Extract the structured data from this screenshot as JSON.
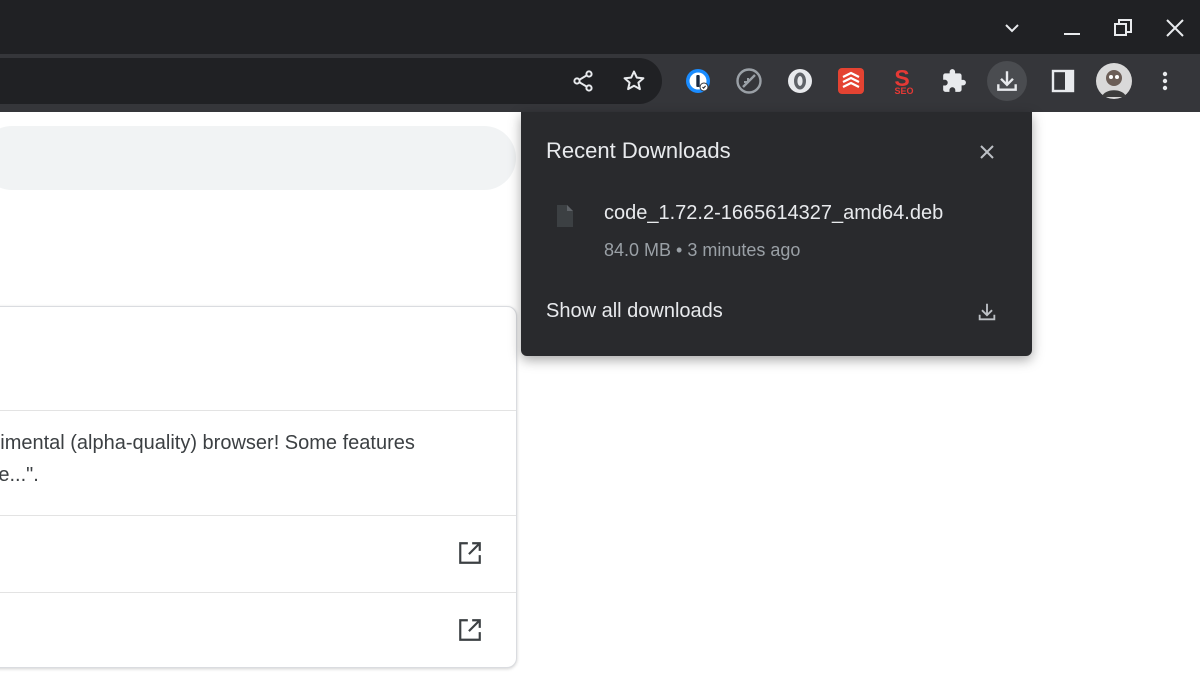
{
  "window_controls": {
    "icons": [
      "chevron-down-icon",
      "minimize-icon",
      "restore-icon",
      "close-icon"
    ]
  },
  "toolbar": {
    "omnibox_icons": [
      "share-icon",
      "star-icon"
    ],
    "extension_icons": [
      "1password-icon",
      "blocker-icon",
      "circle-extension-icon",
      "todoist-icon",
      "seo-icon",
      "puzzle-icon"
    ],
    "seo_label": "SEO",
    "downloads_icon": "download-icon",
    "sidepanel_icon": "side-panel-icon",
    "menu_icon": "kebab-menu-icon",
    "colors": {
      "titlebar": "#202124",
      "toolbar": "#35363a",
      "omnibox": "#202124"
    }
  },
  "page": {
    "card_text_line1": "Experimental (alpha-quality) browser! Some features",
    "card_text_line2": "an issue...\"."
  },
  "downloads_bubble": {
    "title": "Recent Downloads",
    "file_name": "code_1.72.2-1665614327_amd64.deb",
    "file_meta": "84.0 MB • 3 minutes ago",
    "show_all_label": "Show all downloads",
    "colors": {
      "background": "#292a2d",
      "text": "#e8eaed",
      "secondary": "#9aa0a6"
    }
  }
}
